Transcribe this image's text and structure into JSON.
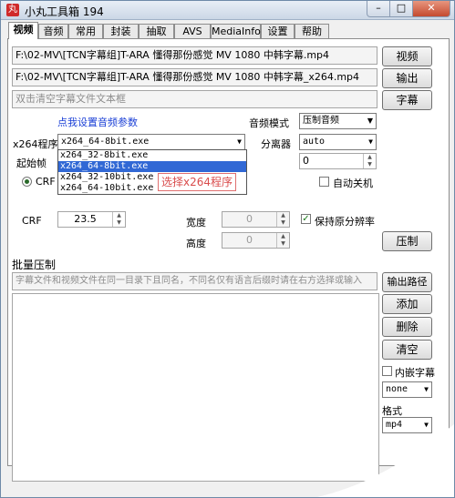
{
  "window": {
    "title": "小丸工具箱 194",
    "icon_text": "丸"
  },
  "window_buttons": {
    "minimize": "–",
    "maximize": "□",
    "close": "✕"
  },
  "tabs": [
    {
      "label": "视频",
      "active": true
    },
    {
      "label": "音频"
    },
    {
      "label": "常用"
    },
    {
      "label": "封装"
    },
    {
      "label": "抽取"
    },
    {
      "label": "AVS"
    },
    {
      "label": "MediaInfo"
    },
    {
      "label": "设置"
    },
    {
      "label": "帮助"
    }
  ],
  "video": {
    "input_path": "F:\\02-MV\\[TCN字幕组]T-ARA 懂得那份感觉 MV 1080 中韩字幕.mp4",
    "output_path": "F:\\02-MV\\[TCN字幕组]T-ARA 懂得那份感觉 MV 1080 中韩字幕_x264.mp4",
    "subtitle_placeholder": "双击清空字幕文件文本框",
    "video_button": "视频",
    "output_button": "输出",
    "subtitle_button": "字幕",
    "audio_params_link": "点我设置音频参数",
    "audio_mode_label": "音频模式",
    "audio_mode_value": "压制音频",
    "x264_label": "x264程序",
    "x264_value": "x264_64-8bit.exe",
    "x264_options": [
      "x264_32-8bit.exe",
      "x264_64-8bit.exe",
      "x264_32-10bit.exe",
      "x264_64-10bit.exe"
    ],
    "x264_selected_index": 1,
    "splitter_label": "分离器",
    "splitter_value": "auto",
    "start_frame_label": "起始帧",
    "start_frame_value": "0",
    "crf_radio_label": "CRF",
    "auto_shutdown_label": "自动关机",
    "crf_label": "CRF",
    "crf_value": "23.5",
    "width_label": "宽度",
    "width_value": "0",
    "height_label": "高度",
    "height_value": "0",
    "keep_resolution_label": "保持原分辨率",
    "keep_resolution_checked": true,
    "encode_button": "压制",
    "annotation": "选择x264程序"
  },
  "batch": {
    "title": "批量压制",
    "hint": "字幕文件和视频文件在同一目录下且同名，不同名仅有语言后缀时请在右方选择或输入",
    "output_path_button": "输出路径",
    "add_button": "添加",
    "delete_button": "删除",
    "clear_button": "清空",
    "embed_subtitle_label": "内嵌字幕",
    "subtitle_lang_value": "none",
    "format_label": "格式",
    "format_value": "mp4"
  }
}
